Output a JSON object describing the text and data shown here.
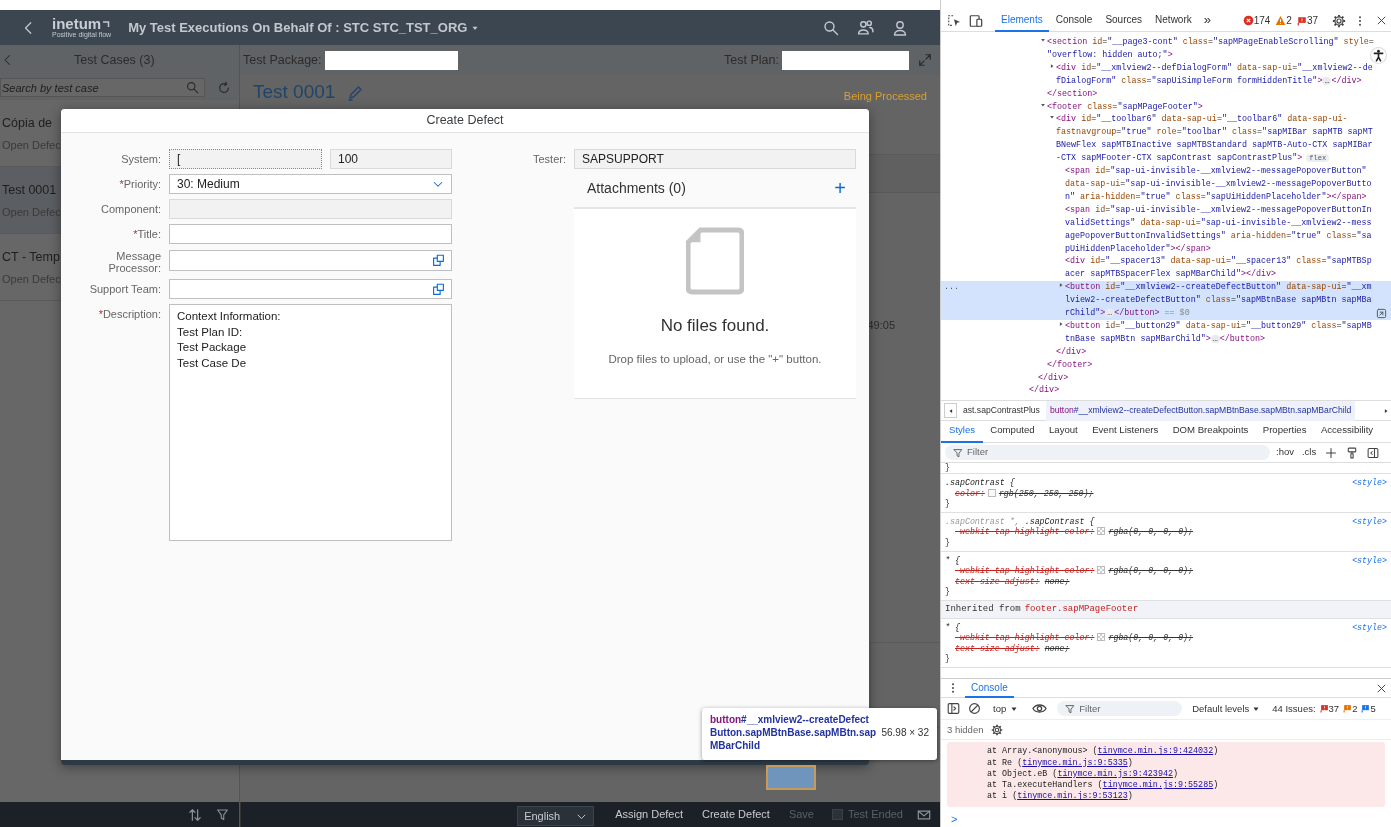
{
  "app": {
    "header": {
      "logo": "inetum",
      "tagline": "Positive digital flow",
      "title": "My Test Executions On Behalf Of : STC STC_TST_ORG"
    },
    "master": {
      "title": "Test Cases (3)",
      "search_placeholder": "Search by test case",
      "items": [
        {
          "title": "Cópia de",
          "subtitle": "Open Defec",
          "selected": false
        },
        {
          "title": "Test 0001",
          "subtitle": "Open Defec",
          "selected": true
        },
        {
          "title": "CT - Temp",
          "subtitle": "Open Defec",
          "selected": false
        }
      ]
    },
    "detail": {
      "package_label": "Test Package:",
      "plan_label": "Test Plan:",
      "title": "Test 0001",
      "status": "Being Processed",
      "time_fragment": "49:05"
    },
    "footer": {
      "language": "English",
      "actions": [
        {
          "label": "Assign Defect",
          "disabled": false
        },
        {
          "label": "Create Defect",
          "disabled": false
        },
        {
          "label": "Save",
          "disabled": true
        }
      ],
      "test_ended": {
        "label": "Test Ended",
        "checked": false,
        "disabled": true
      }
    }
  },
  "dialog": {
    "title": "Create Defect",
    "fields": [
      {
        "kind": "pair",
        "label": "System:",
        "value": "[",
        "value_2": "100"
      },
      {
        "kind": "select",
        "label": "Priority:",
        "required_mark": "*",
        "value": "30: Medium"
      },
      {
        "kind": "readonly",
        "label": "Component:"
      },
      {
        "kind": "text",
        "label": "Title:",
        "required_mark": "*"
      },
      {
        "kind": "valuehelp",
        "label": "Message Processor:"
      },
      {
        "kind": "valuehelp",
        "label": "Support Team:"
      },
      {
        "kind": "textarea",
        "label": "Description:",
        "required_mark": "*",
        "lines": [
          "Context Information:",
          "Test Plan ID:",
          "Test Package",
          "Test Case De"
        ]
      }
    ],
    "tester": {
      "label": "Tester:",
      "value": "SAPSUPPORT"
    },
    "attachments": {
      "title": "Attachments (0)",
      "add": "+",
      "empty_title": "No files found.",
      "empty_text": "Drop files to upload, or use the \"+\" button."
    }
  },
  "inspect_tooltip": {
    "tag": "button",
    "selector": "#__xmlview2--createDefect\nButton.sapMBtnBase.sapMBtn.sap\nMBarChild",
    "size": "56.98 × 32"
  },
  "devtools": {
    "tabs": [
      {
        "label": "Elements",
        "selected": true
      },
      {
        "label": "Console",
        "selected": false
      },
      {
        "label": "Sources",
        "selected": false
      },
      {
        "label": "Network",
        "selected": false
      }
    ],
    "more": "»",
    "errors": "174",
    "warnings": "2",
    "issues": "37",
    "dom_tree": [
      {
        "closing": "</div>",
        "children": [
          {
            "closing": "</div>",
            "children": [
              {
                "lines": [
                  "<section id=\"__page3-cont\" class=\"sapMPageEnableScrolling\" style=",
                  "\"overflow: hidden auto;\">"
                ],
                "expanded": true,
                "selected": false,
                "closing": "</section>",
                "children": [
                  {
                    "lines": [
                      "<div id=\"__xmlview2--defDialogForm\" data-sap-ui=\"__xmlview2--de",
                      "fDialogForm\" class=\"sapUiSimpleForm formHiddenTitle\">…</div>"
                    ],
                    "expanded": false,
                    "selected": false
                  }
                ]
              },
              {
                "lines": [
                  "<footer class=\"sapMPageFooter\">"
                ],
                "expanded": true,
                "selected": false,
                "closing": "</footer>",
                "children": [
                  {
                    "lines": [
                      "<div id=\"__toolbar6\" data-sap-ui=\"__toolbar6\" data-sap-ui-",
                      "fastnavgroup=\"true\" role=\"toolbar\" class=\"sapMIBar sapMTB sapMT",
                      "BNewFlex sapMTBInactive sapMTBStandard sapMTB-Auto-CTX sapMIBar",
                      "-CTX sapMFooter-CTX sapContrast sapContrastPlus\">"
                    ],
                    "badge": "flex",
                    "expanded": true,
                    "selected": false,
                    "closing": "</div>",
                    "children": [
                      {
                        "lines": [
                          "<span id=\"sap-ui-invisible-__xmlview2--messagePopoverButton\"",
                          "data-sap-ui=\"sap-ui-invisible-__xmlview2--messagePopoverButto",
                          "n\" aria-hidden=\"true\" class=\"sapUiHiddenPlaceholder\"></span>"
                        ],
                        "selected": false
                      },
                      {
                        "lines": [
                          "<span id=\"sap-ui-invisible-__xmlview2--messagePopoverButtonIn",
                          "validSettings\" data-sap-ui=\"sap-ui-invisible-__xmlview2--mess",
                          "agePopoverButtonInvalidSettings\" aria-hidden=\"true\" class=\"sa",
                          "pUiHiddenPlaceholder\"></span>"
                        ],
                        "selected": false
                      },
                      {
                        "lines": [
                          "<div id=\"__spacer13\" data-sap-ui=\"__spacer13\" class=\"sapMTBSp",
                          "acer sapMTBSpacerFlex sapMBarChild\"></div>"
                        ],
                        "selected": false
                      },
                      {
                        "lines": [
                          "<button id=\"__xmlview2--createDefectButton\" data-sap-ui=\"__xm",
                          "lview2--createDefectButton\" class=\"sapMBtnBase sapMBtn sapMBa",
                          "rChild\">…</button>"
                        ],
                        "suffix": " == $0",
                        "gutter": "...",
                        "expanded": false,
                        "selected": true
                      },
                      {
                        "lines": [
                          "<button id=\"__button29\" data-sap-ui=\"__button29\" class=\"sapMB",
                          "tnBase sapMBtn sapMBarChild\">…</button>"
                        ],
                        "expanded": false,
                        "selected": false
                      }
                    ]
                  }
                ]
              }
            ]
          }
        ]
      }
    ],
    "breadcrumbs": [
      {
        "rest": "ast.sapContrastPlus",
        "selected": false
      },
      {
        "tag": "button",
        "rest": "#__xmlview2--createDefectButton.sapMBtnBase.sapMBtn.sapMBarChild",
        "selected": true
      }
    ],
    "sub_tabs": [
      {
        "label": "Styles",
        "selected": true
      },
      {
        "label": "Computed",
        "selected": false
      },
      {
        "label": "Layout",
        "selected": false
      },
      {
        "label": "Event Listeners",
        "selected": false
      },
      {
        "label": "DOM Breakpoints",
        "selected": false
      },
      {
        "label": "Properties",
        "selected": false
      },
      {
        "label": "Accessibility",
        "selected": false
      }
    ],
    "styles_filter": "Filter",
    "hov": ":hov",
    "cls": ".cls",
    "styles": {
      "top_brace": "}",
      "rules": [
        {
          "selector": ".sapContrast {",
          "source": "<style>",
          "close": "}",
          "declarations": [
            {
              "property": "color:",
              "value": "rgb(250, 250, 250);",
              "color": "#fafafa",
              "overridden": true
            }
          ]
        },
        {
          "selector_muted": ".sapContrast *,",
          "selector": ".sapContrast {",
          "source": "<style>",
          "close": "}",
          "declarations": [
            {
              "property": "-webkit-tap-highlight-color:",
              "value": "rgba(0, 0, 0, 0);",
              "transparent_swatch": true,
              "overridden": true
            }
          ]
        },
        {
          "selector": "* {",
          "source": "<style>",
          "close": "}",
          "declarations": [
            {
              "property": "-webkit-tap-highlight-color:",
              "value": "rgba(0, 0, 0, 0);",
              "transparent_swatch": true,
              "overridden": true
            },
            {
              "property": "text-size-adjust:",
              "value": "none;",
              "overridden": true
            }
          ]
        },
        {
          "inherited_label": "Inherited from",
          "inherited_from": "footer.sapMPageFooter",
          "selector": "* {",
          "source": "<style>",
          "close": "}",
          "declarations": [
            {
              "property": "-webkit-tap-highlight-color:",
              "value": "rgba(0, 0, 0, 0);",
              "transparent_swatch": true,
              "overridden": true
            },
            {
              "property": "text-size-adjust:",
              "value": "none;",
              "overridden": true
            }
          ]
        }
      ]
    },
    "console": {
      "title": "Console",
      "context": "top",
      "filter": "Filter",
      "levels": "Default levels",
      "issues_label": "44 Issues:",
      "issue_counts": [
        {
          "count": "37",
          "color": "#d93025"
        },
        {
          "count": "2",
          "color": "#e37400"
        },
        {
          "count": "5",
          "color": "#1a73e8"
        }
      ],
      "hidden": "3 hidden",
      "stack": [
        {
          "before": "at Array.<anonymous> (",
          "link": "tinymce.min.js:9:424032",
          "after": ")"
        },
        {
          "before": "at Re (",
          "link": "tinymce.min.js:9:5335",
          "after": ")"
        },
        {
          "before": "at Object.eB (",
          "link": "tinymce.min.js:9:423942",
          "after": ")"
        },
        {
          "before": "at Ta.executeHandlers (",
          "link": "tinymce.min.js:9:55285",
          "after": ")"
        },
        {
          "before": "at i (",
          "link": "tinymce.min.js:9:53123",
          "after": ")"
        }
      ],
      "prompt": ">"
    }
  }
}
